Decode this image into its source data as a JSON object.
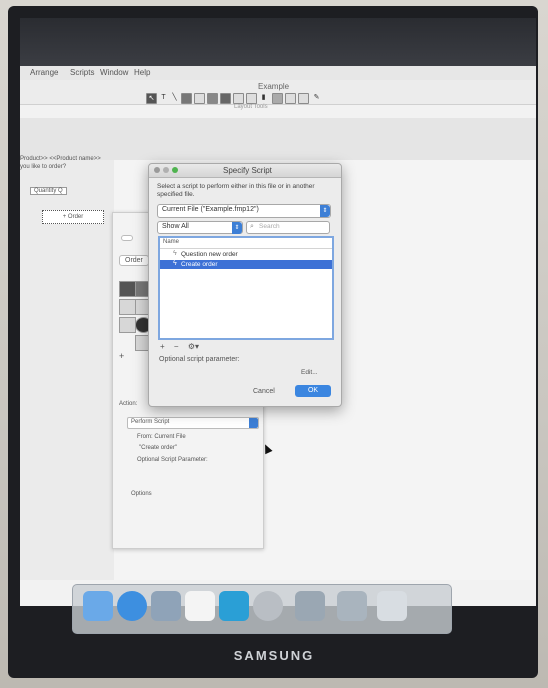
{
  "menubar": {
    "items": [
      "Arrange",
      "Scripts",
      "Window",
      "Help"
    ]
  },
  "window": {
    "title": "Example",
    "toolbar_label": "Layout Tools"
  },
  "layout": {
    "field_text_1": "Product>> <<Product name>>",
    "field_text_2": "you like to order?",
    "quantity_field": "Quantity Q",
    "order_button": "+ Order"
  },
  "inspector": {
    "tab_button": "Order",
    "action_label": "Action:",
    "action_value": "Perform Script",
    "from_label": "From: Current File",
    "script_name": "\"Create order\"",
    "param_label": "Optional Script Parameter:",
    "options_label": "Options"
  },
  "dialog": {
    "title": "Specify Script",
    "instruction": "Select a script to perform either in this file or in another specified file.",
    "file_selector": "Current File (\"Example.fmp12\")",
    "show_filter": "Show All",
    "search_placeholder": "Search",
    "list_header": "Name",
    "scripts": [
      {
        "name": "Question new order",
        "selected": false
      },
      {
        "name": "Create order",
        "selected": true
      }
    ],
    "param_label": "Optional script parameter:",
    "edit_button": "Edit...",
    "cancel_button": "Cancel",
    "ok_button": "OK"
  },
  "brand": "SAMSUNG",
  "colors": {
    "accent": "#3d71d6",
    "ok_button": "#3b86e0"
  }
}
